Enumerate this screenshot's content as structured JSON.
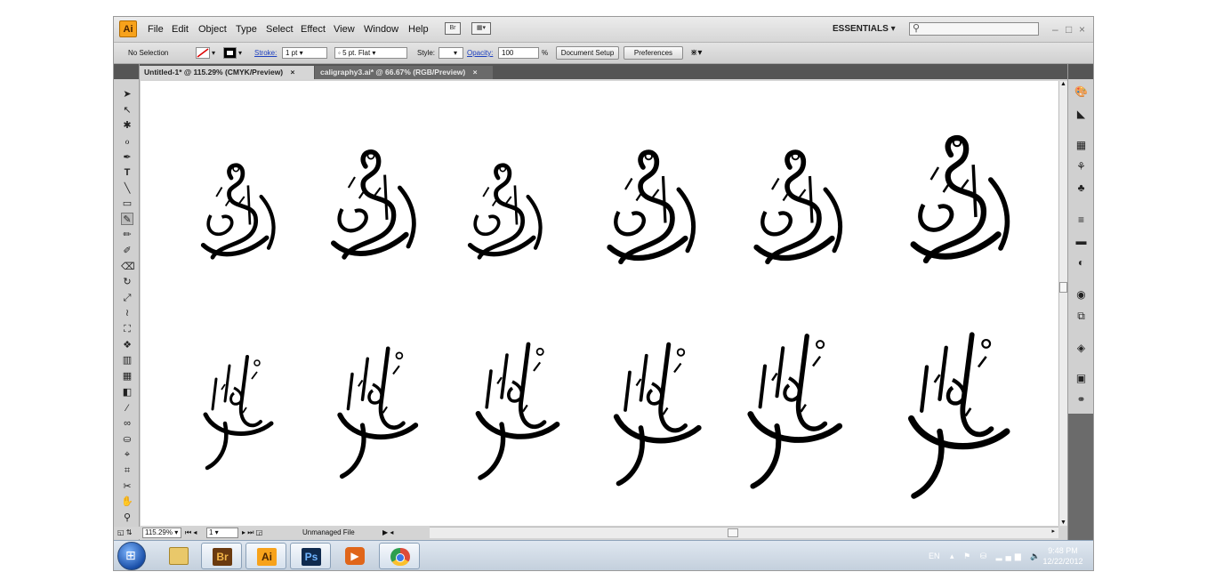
{
  "app": {
    "logo": "Ai"
  },
  "menu": [
    "File",
    "Edit",
    "Object",
    "Type",
    "Select",
    "Effect",
    "View",
    "Window",
    "Help"
  ],
  "menubar_icons": {
    "bridge": "Br",
    "arrange": "arrange-icon"
  },
  "workspace": {
    "label": "ESSENTIALS",
    "search_value": "",
    "search_icon": "search-icon"
  },
  "window_controls": {
    "minimize": "–",
    "maximize": "□",
    "close": "×"
  },
  "control": {
    "selection": "No Selection",
    "stroke_label": "Stroke:",
    "stroke_weight": "1 pt",
    "brush": "5 pt. Flat",
    "style_label": "Style:",
    "opacity_label": "Opacity:",
    "opacity_value": "100",
    "opacity_unit": "%",
    "doc_setup": "Document Setup",
    "preferences": "Preferences"
  },
  "tabs": [
    {
      "label": "Untitled-1* @ 115.29% (CMYK/Preview)",
      "close": "×"
    },
    {
      "label": "caligraphy3.ai* @ 66.67% (RGB/Preview)",
      "close": "×"
    }
  ],
  "status": {
    "zoom": "115.29%",
    "page": "1",
    "info": "Unmanaged File"
  },
  "taskbar": {
    "apps": [
      {
        "name": "explorer",
        "label": ""
      },
      {
        "name": "bridge",
        "label": "Br",
        "color": "#e0a12a"
      },
      {
        "name": "illustrator",
        "label": "Ai",
        "color": "#f7a21b"
      },
      {
        "name": "photoshop",
        "label": "Ps",
        "color": "#2d7fd6"
      },
      {
        "name": "media",
        "label": "",
        "color": "#e0661a"
      },
      {
        "name": "chrome",
        "label": "",
        "color": "#dd4b39"
      }
    ],
    "lang": "EN",
    "time": "9:48 PM",
    "date": "12/22/2012"
  }
}
